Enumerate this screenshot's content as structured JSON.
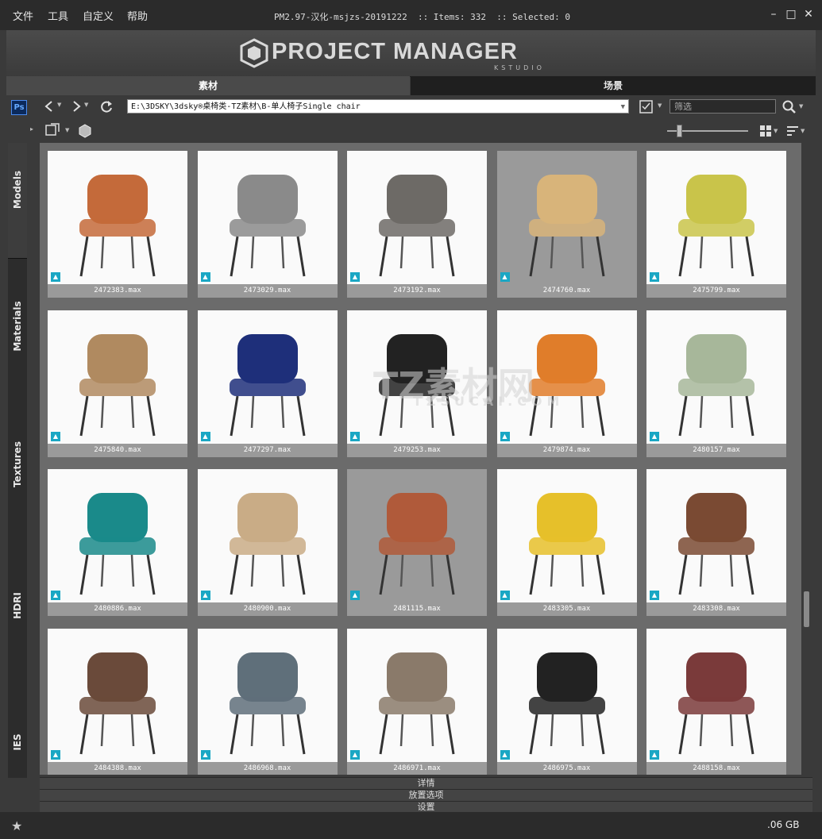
{
  "menu": [
    "文件",
    "工具",
    "自定义",
    "帮助"
  ],
  "window": {
    "title": "PM2.97-汉化-msjzs-20191222  :: Items: 332  :: Selected: 0"
  },
  "banner": {
    "title": "PROJECT MANAGER",
    "subtitle": "KSTUDIO"
  },
  "tabs": [
    "素材",
    "场景"
  ],
  "toolbar": {
    "ps_label": "Ps",
    "path": "E:\\3DSKY\\3dsky®桌椅类-TZ素材\\B-单人椅子Single chair",
    "filter_placeholder": "筛选"
  },
  "sidebar": [
    "Models",
    "Materials",
    "Textures",
    "HDRI",
    "IES"
  ],
  "items": [
    {
      "file": "2472383.max",
      "color": "#c46a3a"
    },
    {
      "file": "2473029.max",
      "color": "#8a8a8a"
    },
    {
      "file": "2473192.max",
      "color": "#6d6a66"
    },
    {
      "file": "2474760.max",
      "color": "#d8b47a"
    },
    {
      "file": "2475799.max",
      "color": "#c9c44a"
    },
    {
      "file": "2475840.max",
      "color": "#b08a60"
    },
    {
      "file": "2477297.max",
      "color": "#1e2f7a"
    },
    {
      "file": "2479253.max",
      "color": "#222222"
    },
    {
      "file": "2479874.max",
      "color": "#e07d2a"
    },
    {
      "file": "2480157.max",
      "color": "#a7b79a"
    },
    {
      "file": "2480886.max",
      "color": "#1a8a8a"
    },
    {
      "file": "2480900.max",
      "color": "#c9ac86"
    },
    {
      "file": "2481115.max",
      "color": "#b05a3a"
    },
    {
      "file": "2483305.max",
      "color": "#e6c02a"
    },
    {
      "file": "2483308.max",
      "color": "#7a4a33"
    },
    {
      "file": "2484388.max",
      "color": "#6a4a3a"
    },
    {
      "file": "2486968.max",
      "color": "#5f6f7a"
    },
    {
      "file": "2486971.max",
      "color": "#8a7a6a"
    },
    {
      "file": "2486975.max",
      "color": "#222222"
    },
    {
      "file": "2488158.max",
      "color": "#7a3a3a"
    }
  ],
  "panels": [
    "详情",
    "放置选项",
    "设置"
  ],
  "status": {
    "disk": ".06 GB"
  },
  "watermark": {
    "cn": "TZ素材网",
    "en": "TZSUCAI.COM"
  },
  "icons": {
    "ps": "photoshop-icon",
    "back": "back-arrow-icon",
    "forward": "forward-arrow-icon",
    "refresh": "refresh-icon",
    "search": "search-icon",
    "grid": "grid-view-icon",
    "sort": "sort-icon",
    "star": "star-icon"
  }
}
